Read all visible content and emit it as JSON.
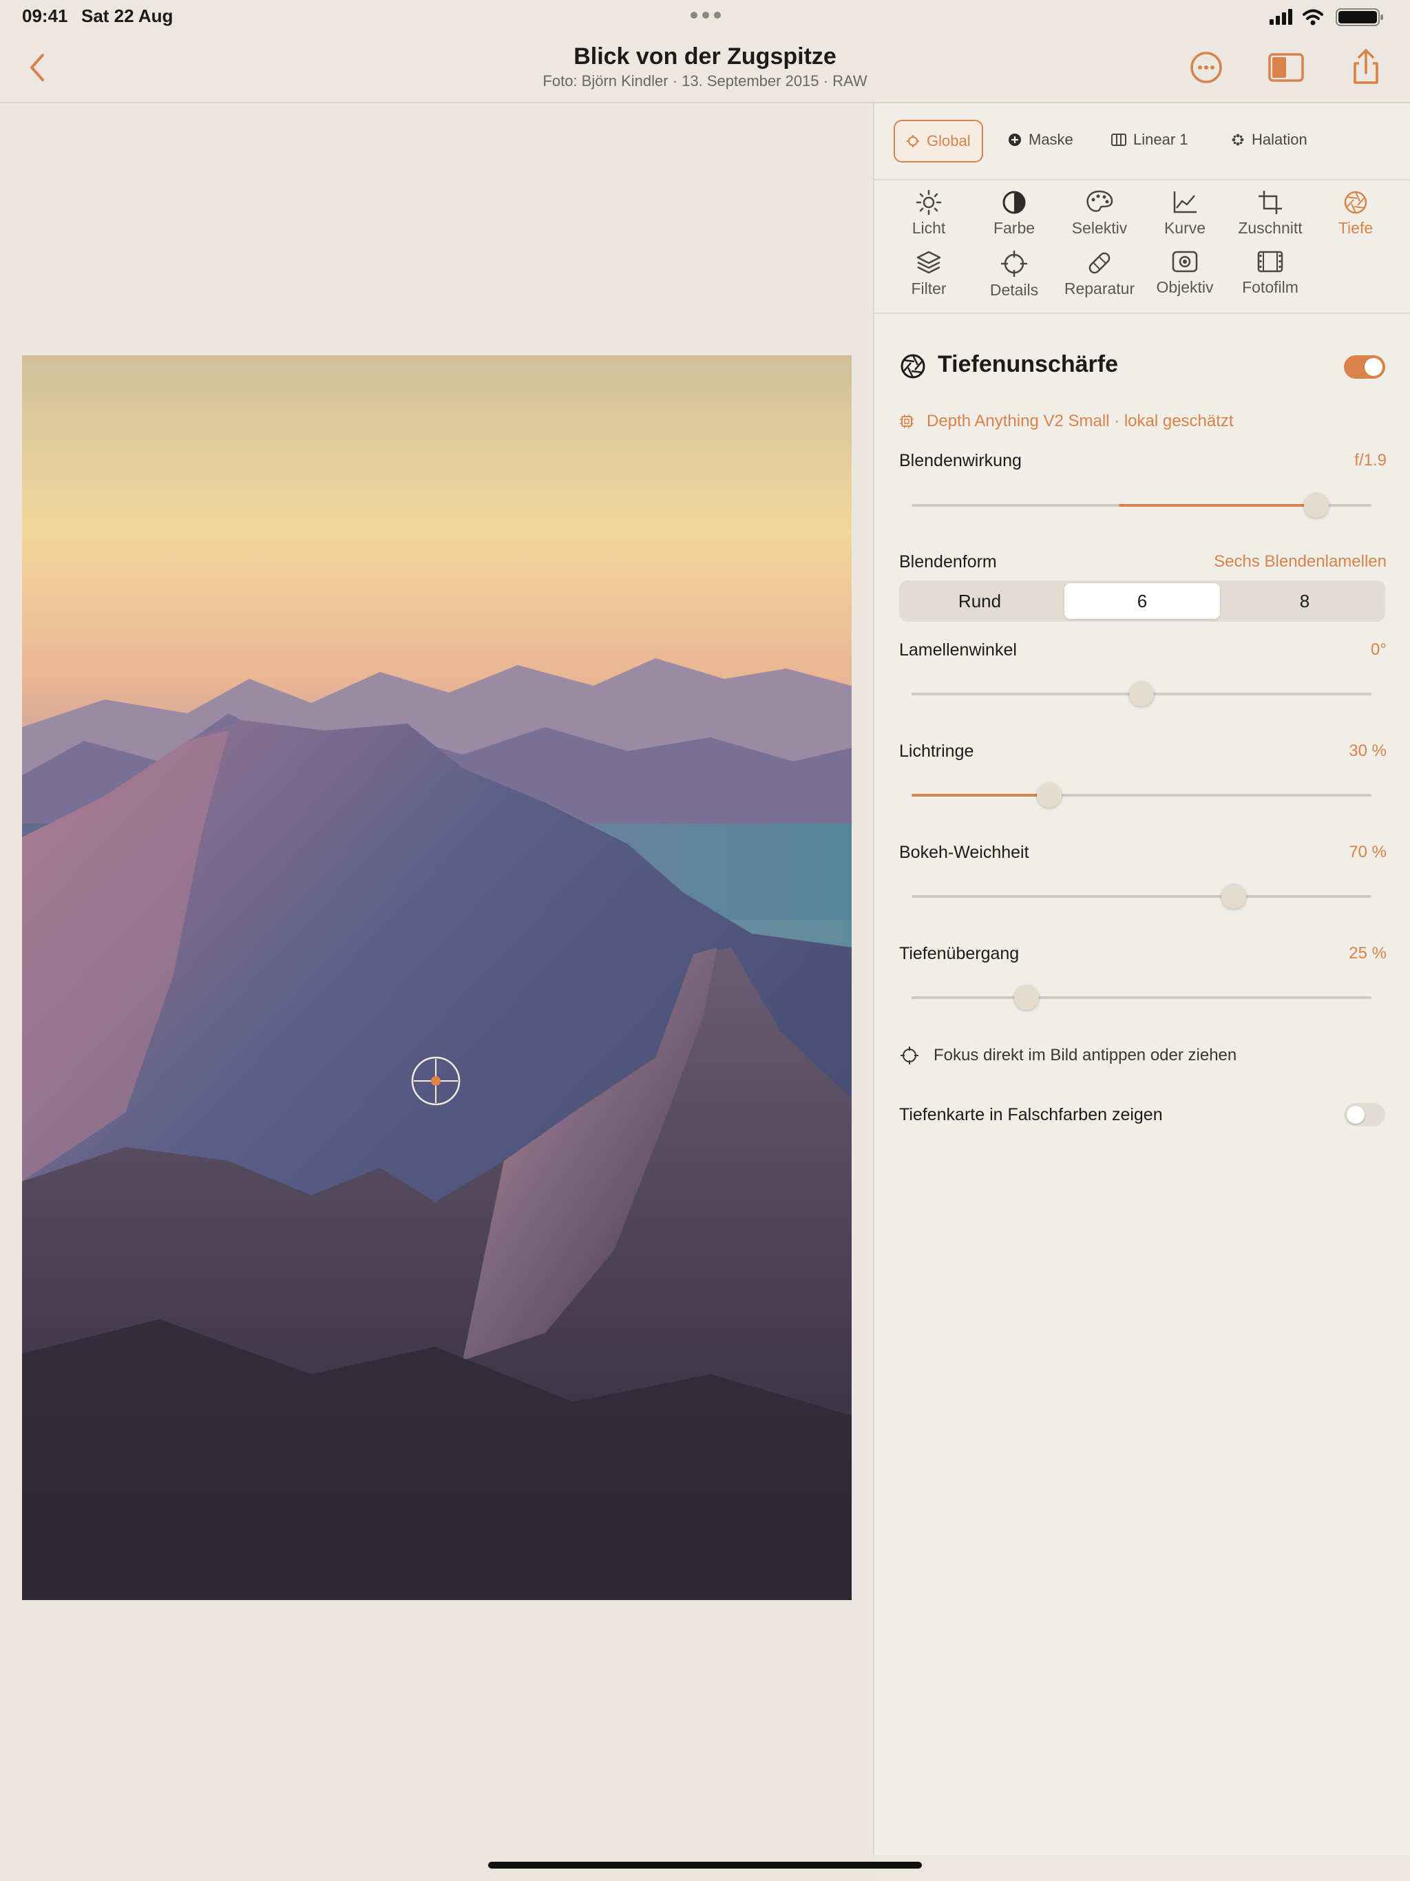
{
  "status": {
    "time": "09:41",
    "date": "Sat 22 Aug"
  },
  "nav": {
    "title": "Blick von der Zugspitze",
    "subtitle": "Foto: Björn Kindler · 13. September 2015 · RAW"
  },
  "mode_tabs": [
    {
      "label": "Global",
      "icon": "target-icon"
    },
    {
      "label": "Maske",
      "icon": "plus-circle-icon"
    },
    {
      "label": "Linear 1",
      "icon": "linear-gradient-icon"
    },
    {
      "label": "Halation",
      "icon": "sparkle-icon"
    }
  ],
  "tools": [
    {
      "label": "Licht",
      "icon": "sun-icon"
    },
    {
      "label": "Farbe",
      "icon": "half-circle-icon"
    },
    {
      "label": "Selektiv",
      "icon": "palette-icon"
    },
    {
      "label": "Kurve",
      "icon": "curve-chart-icon"
    },
    {
      "label": "Zuschnitt",
      "icon": "crop-icon"
    },
    {
      "label": "Tiefe",
      "icon": "aperture-icon"
    },
    {
      "label": "Filter",
      "icon": "layers-icon"
    },
    {
      "label": "Details",
      "icon": "crosshair-icon"
    },
    {
      "label": "Reparatur",
      "icon": "bandage-icon"
    },
    {
      "label": "Objektiv",
      "icon": "lens-icon"
    },
    {
      "label": "Fotofilm",
      "icon": "film-icon"
    }
  ],
  "depth": {
    "title": "Tiefenunschärfe",
    "enabled": true,
    "model": "Depth Anything V2 Small · lokal geschätzt",
    "aperture_effect": {
      "label": "Blendenwirkung",
      "value": "f/1.9",
      "position": 0.88
    },
    "blade_shape": {
      "label": "Blendenform",
      "value": "Sechs Blendenlamellen",
      "options": [
        "Rund",
        "6",
        "8"
      ],
      "selected": "6"
    },
    "blade_angle": {
      "label": "Lamellenwinkel",
      "value": "0°",
      "position": 0.5
    },
    "light_rings": {
      "label": "Lichtringe",
      "value": "30 %",
      "position": 0.3
    },
    "bokeh_softness": {
      "label": "Bokeh-Weichheit",
      "value": "70 %",
      "position": 0.7
    },
    "depth_transition": {
      "label": "Tiefenübergang",
      "value": "25 %",
      "position": 0.25
    },
    "focus_hint": "Fokus direkt im Bild antippen oder ziehen",
    "false_color": {
      "label": "Tiefenkarte in Falschfarben zeigen",
      "enabled": false
    }
  },
  "colors": {
    "accent": "#d9824a",
    "panel": "#f1eee8",
    "canvas": "#ebe7e0"
  }
}
